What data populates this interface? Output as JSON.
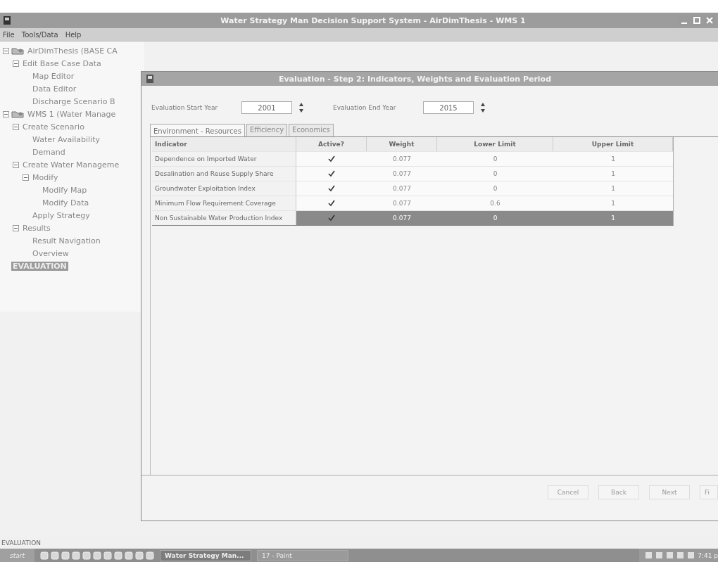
{
  "window": {
    "title": "Water Strategy Man Decision Support System - AirDimThesis - WMS 1"
  },
  "menu": [
    "File",
    "Tools/Data",
    "Help"
  ],
  "tree": [
    {
      "label": "AirDimThesis (BASE CA",
      "expanded": true,
      "selected": false,
      "children": [
        {
          "label": "Edit Base Case Data",
          "expanded": true,
          "selected": false,
          "children": [
            {
              "label": "Map Editor",
              "selected": false
            },
            {
              "label": "Data Editor",
              "selected": false
            },
            {
              "label": "Discharge Scenario B",
              "selected": false
            }
          ]
        }
      ]
    },
    {
      "label": "WMS 1 (Water Manage",
      "expanded": true,
      "selected": false,
      "children": [
        {
          "label": "Create Scenario",
          "expanded": true,
          "selected": false,
          "children": [
            {
              "label": "Water Availability",
              "selected": false
            },
            {
              "label": "Demand",
              "selected": false
            }
          ]
        },
        {
          "label": "Create Water Manageme",
          "expanded": true,
          "selected": false,
          "children": [
            {
              "label": "Modify",
              "expanded": true,
              "selected": false,
              "children": [
                {
                  "label": "Modify Map",
                  "selected": false
                },
                {
                  "label": "Modify Data",
                  "selected": false
                }
              ]
            },
            {
              "label": "Apply Strategy",
              "selected": false
            }
          ]
        },
        {
          "label": "Results",
          "expanded": true,
          "selected": false,
          "children": [
            {
              "label": "Result Navigation",
              "selected": false
            },
            {
              "label": "Overview",
              "selected": false
            }
          ]
        }
      ]
    },
    {
      "label": "EVALUATION",
      "selected": true
    }
  ],
  "dialog": {
    "title": "Evaluation - Step 2: Indicators, Weights and Evaluation Period",
    "start_year": {
      "label": "Evaluation Start Year",
      "value": "2001"
    },
    "end_year": {
      "label": "Evaluation End Year",
      "value": "2015"
    },
    "tabs": [
      {
        "label": "Environment - Resources",
        "selected": true
      },
      {
        "label": "Efficiency",
        "selected": false
      },
      {
        "label": "Economics",
        "selected": false
      }
    ],
    "columns": [
      "Indicator",
      "Active?",
      "Weight",
      "Lower Limit",
      "Upper Limit"
    ],
    "rows": [
      {
        "indicator": "Dependence on Imported Water",
        "active": true,
        "weight": "0.077",
        "lower": "0",
        "upper": "1",
        "selected": false
      },
      {
        "indicator": "Desalination and Reuse Supply Share",
        "active": true,
        "weight": "0.077",
        "lower": "0",
        "upper": "1",
        "selected": false
      },
      {
        "indicator": "Groundwater Exploitation Index",
        "active": true,
        "weight": "0.077",
        "lower": "0",
        "upper": "1",
        "selected": false
      },
      {
        "indicator": "Minimum Flow Requirement Coverage",
        "active": true,
        "weight": "0.077",
        "lower": "0.6",
        "upper": "1",
        "selected": false
      },
      {
        "indicator": "Non Sustainable Water Production Index",
        "active": true,
        "weight": "0.077",
        "lower": "0",
        "upper": "1",
        "selected": true
      }
    ],
    "buttons": [
      "Cancel",
      "Back",
      "Next",
      "Fi"
    ]
  },
  "status_bar": "EVALUATION",
  "taskbar": {
    "start": "start",
    "tasks": [
      "Water Strategy Man...",
      "17 - Paint"
    ],
    "clock": "7:41 p"
  }
}
